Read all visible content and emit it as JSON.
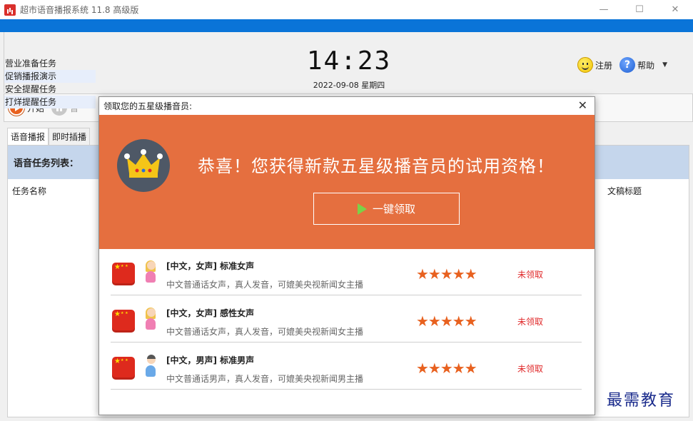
{
  "app": {
    "title": "超市语音播报系统 11.8 高级版",
    "window_controls": [
      "—",
      "☐",
      "✕"
    ]
  },
  "header": {
    "clock": "14:23",
    "date": "2022-09-08 星期四",
    "register_label": "注册",
    "help_label": "帮助",
    "help_caret": "▼"
  },
  "toolbar": {
    "start_label": "开始",
    "pause_label": "暂"
  },
  "tabs": [
    {
      "label": "语音播报",
      "active": true
    },
    {
      "label": "即时插播",
      "active": false
    }
  ],
  "panel": {
    "title": "语音任务列表：",
    "col_task": "任务名称",
    "col_doc_title": "文稿标题",
    "tasks": [
      "营业准备任务",
      "促销播报演示",
      "安全提醒任务",
      "打烊提醒任务"
    ]
  },
  "dialog": {
    "title": "领取您的五星级播音员:",
    "close_glyph": "✕",
    "banner_text": "恭喜！您获得新款五星级播音员的试用资格！",
    "claim_label": "一键领取",
    "voices": [
      {
        "name": "[中文，女声] 标准女声",
        "desc": "中文普通话女声，真人发音，可媲美央视新闻女主播",
        "rating": "★★★★★",
        "status": "未领取",
        "gender": "female"
      },
      {
        "name": "[中文，女声] 感性女声",
        "desc": "中文普通话女声，真人发音，可媲美央视新闻女主播",
        "rating": "★★★★★",
        "status": "未领取",
        "gender": "female"
      },
      {
        "name": "[中文，男声] 标准男声",
        "desc": "中文普通话男声，真人发音，可媲美央视新闻男主播",
        "rating": "★★★★★",
        "status": "未领取",
        "gender": "male"
      }
    ]
  },
  "watermark": "最需教育",
  "colors": {
    "accent_blue": "#0a74d8",
    "banner_orange": "#e56f3f",
    "status_red": "#e0292a",
    "star_orange": "#e8611f",
    "panel_header": "#c5d6ec"
  }
}
